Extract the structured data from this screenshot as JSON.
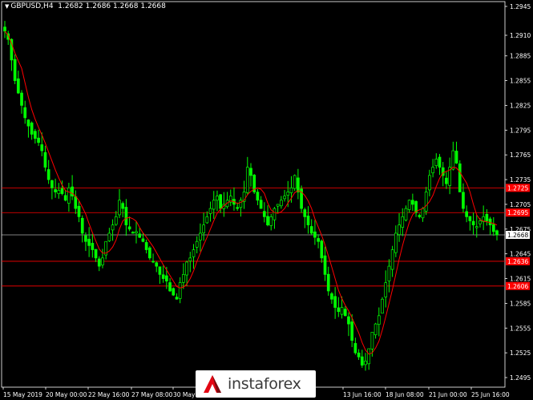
{
  "chart": {
    "symbol_label": "GBPUSD,H4",
    "ohlc_text": "1.2682 1.2686 1.2668 1.2668",
    "current_price": "1.2668",
    "colors": {
      "background": "#000000",
      "candle": "#00ff00",
      "moving_average": "#ff0000",
      "level": "#ff0000",
      "axis_text": "#ffffff"
    },
    "watermark": "instaforex"
  },
  "chart_data": {
    "type": "candlestick",
    "price_axis": {
      "range": [
        1.2495,
        1.2945
      ],
      "ticks": [
        "1.2945",
        "1.2910",
        "1.2885",
        "1.2855",
        "1.2825",
        "1.2795",
        "1.2765",
        "1.2735",
        "1.2705",
        "1.2675",
        "1.2645",
        "1.2615",
        "1.2585",
        "1.2555",
        "1.2525",
        "1.2495"
      ]
    },
    "date_axis": {
      "ticks": [
        "15 May 2019",
        "20 May 00:00",
        "22 May 16:00",
        "27 May 08:00",
        "30 May",
        "13 Jun 16:00",
        "18 Jun 08:00",
        "21 Jun 00:00",
        "25 Jun 16:00"
      ]
    },
    "levels": [
      {
        "price": 1.2725,
        "label": "1.2725"
      },
      {
        "price": 1.2695,
        "label": "1.2695"
      },
      {
        "price": 1.2636,
        "label": "1.2636"
      },
      {
        "price": 1.2606,
        "label": "1.2606"
      }
    ],
    "close_path": [
      1.2915,
      1.2905,
      1.288,
      1.2855,
      1.284,
      1.2825,
      1.281,
      1.28,
      1.279,
      1.2785,
      1.278,
      1.277,
      1.275,
      1.2735,
      1.2725,
      1.272,
      1.2722,
      1.2718,
      1.271,
      1.2725,
      1.2715,
      1.27,
      1.269,
      1.267,
      1.266,
      1.2655,
      1.265,
      1.264,
      1.263,
      1.264,
      1.266,
      1.267,
      1.268,
      1.269,
      1.271,
      1.27,
      1.268,
      1.2675,
      1.267,
      1.2672,
      1.2665,
      1.266,
      1.265,
      1.264,
      1.2635,
      1.263,
      1.262,
      1.2615,
      1.2612,
      1.26,
      1.2595,
      1.259,
      1.261,
      1.262,
      1.2635,
      1.264,
      1.265,
      1.266,
      1.267,
      1.268,
      1.269,
      1.27,
      1.271,
      1.2715,
      1.27,
      1.2705,
      1.271,
      1.2715,
      1.2705,
      1.27,
      1.271,
      1.272,
      1.275,
      1.274,
      1.272,
      1.271,
      1.27,
      1.269,
      1.268,
      1.269,
      1.27,
      1.2705,
      1.271,
      1.2715,
      1.272,
      1.2725,
      1.274,
      1.272,
      1.27,
      1.269,
      1.268,
      1.267,
      1.2665,
      1.266,
      1.264,
      1.262,
      1.26,
      1.259,
      1.258,
      1.2575,
      1.258,
      1.257,
      1.256,
      1.254,
      1.2525,
      1.252,
      1.251,
      1.2515,
      1.253,
      1.255,
      1.256,
      1.257,
      1.259,
      1.261,
      1.263,
      1.265,
      1.267,
      1.268,
      1.269,
      1.27,
      1.271,
      1.2705,
      1.2695,
      1.269,
      1.27,
      1.272,
      1.274,
      1.275,
      1.276,
      1.275,
      1.274,
      1.273,
      1.275,
      1.277,
      1.2755,
      1.272,
      1.27,
      1.269,
      1.2685,
      1.268,
      1.2678,
      1.2685,
      1.269,
      1.2685,
      1.268,
      1.2672,
      1.2668
    ]
  }
}
